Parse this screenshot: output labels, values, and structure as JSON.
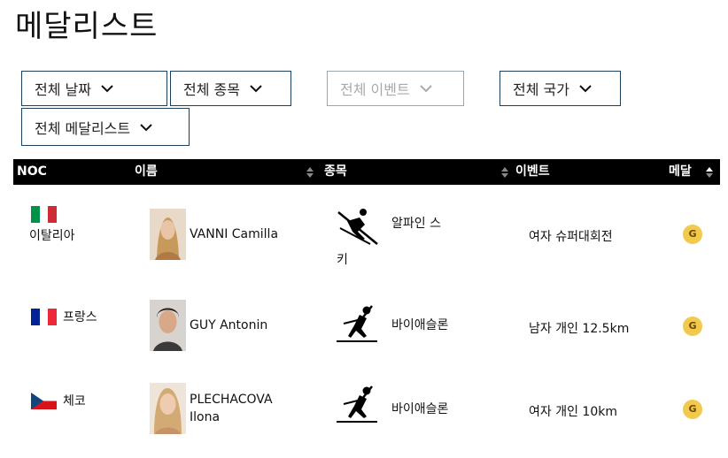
{
  "page": {
    "title": "메달리스트"
  },
  "filters": {
    "date": "전체 날짜",
    "sport": "전체 종목",
    "event": "전체 이벤트",
    "country": "전체 국가",
    "medalist": "전체 메달리스트"
  },
  "table": {
    "headers": {
      "noc": "NOC",
      "name": "이름",
      "sport": "종목",
      "event": "이벤트",
      "medal": "메달"
    },
    "rows": [
      {
        "country": "이탈리아",
        "flag": "flag-italy",
        "name_line1": "VANNI Camilla",
        "name_line2": "",
        "sport_a": "알파인 스",
        "sport_b": "키",
        "sport_icon": "alpine-skiing-icon",
        "event": "여자 슈퍼대회전",
        "medal": "G"
      },
      {
        "country": "프랑스",
        "flag": "flag-france",
        "name_line1": "GUY Antonin",
        "name_line2": "",
        "sport_a": "바이애슬론",
        "sport_b": "",
        "sport_icon": "biathlon-icon",
        "event": "남자 개인 12.5km",
        "medal": "G"
      },
      {
        "country": "체코",
        "flag": "flag-czech",
        "name_line1": "PLECHACOVA",
        "name_line2": "Ilona",
        "sport_a": "바이애슬론",
        "sport_b": "",
        "sport_icon": "biathlon-icon",
        "event": "여자 개인 10km",
        "medal": "G"
      }
    ]
  },
  "colors": {
    "header_bg": "#000000",
    "filter_border": "#1b3f5e",
    "gold_medal": "#f2c94c"
  }
}
